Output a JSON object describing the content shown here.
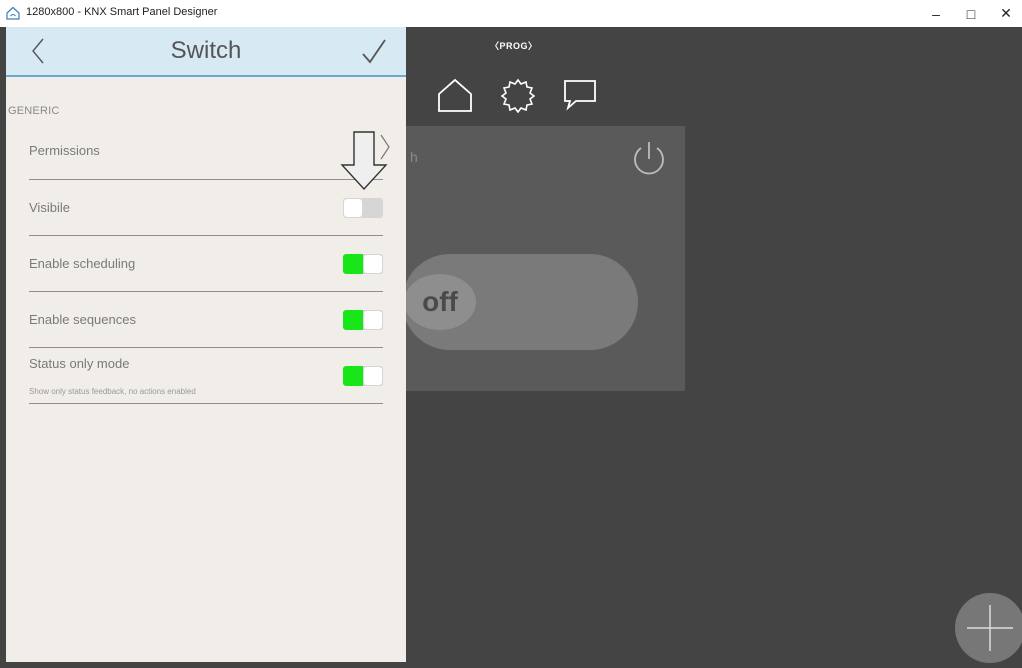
{
  "window": {
    "title": "1280x800 - KNX Smart Panel Designer",
    "minimize": "–",
    "maximize": "□",
    "close": "✕"
  },
  "panel": {
    "title": "Switch",
    "back_icon": "chevron-left-icon",
    "confirm_icon": "checkmark-icon",
    "section": "GENERIC",
    "rows": [
      {
        "label": "Permissions",
        "control": "chevron"
      },
      {
        "label": "Visibile",
        "control": "toggle",
        "on": false
      },
      {
        "label": "Enable scheduling",
        "control": "toggle",
        "on": true
      },
      {
        "label": "Enable sequences",
        "control": "toggle",
        "on": true
      },
      {
        "label": "Status only mode",
        "sublabel": "Show only status feedback, no actions enabled",
        "control": "toggle",
        "on": true
      }
    ]
  },
  "preview": {
    "prog_label": "〈PROG〉",
    "nav_icons": [
      "home-icon",
      "gear-icon",
      "chat-icon"
    ],
    "widget_partial_text": "h",
    "switch_state": "off"
  },
  "colors": {
    "toggle_on": "#19e619",
    "toggle_off": "#d6d6d6",
    "header_bg": "#d7e9f2",
    "header_border": "#6aaad0",
    "panel_bg": "#f1ede8",
    "app_bg": "#444444"
  }
}
